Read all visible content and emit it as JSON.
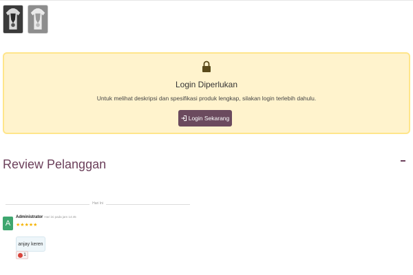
{
  "gallery": {
    "thumbnails": [
      {
        "name": "product-thumbnail-dark",
        "tone": "#3a3a3a"
      },
      {
        "name": "product-thumbnail-light",
        "tone": "#8d8d8d"
      }
    ]
  },
  "login_notice": {
    "icon": "lock-icon",
    "title": "Login Diperlukan",
    "description": "Untuk melihat deskripsi dan spesifikasi produk lengkap, silakan login terlebih dahulu.",
    "button_label": "Login Sekarang",
    "button_icon": "sign-in-icon",
    "background": "#fff3cd",
    "border": "#ffe58a",
    "button_color": "#6b4a5e"
  },
  "reviews": {
    "heading": "Review Pelanggan",
    "collapse_icon": "minus-icon",
    "day_label": "Hari Ini",
    "items": [
      {
        "avatar_letter": "A",
        "avatar_color": "#3ea66f",
        "author": "Administrator",
        "time": "Hari ini pada jam 14:45",
        "rating": 5,
        "comment": "anjay keren",
        "reaction_icon": "heart-reaction-icon",
        "reaction_count": "1"
      }
    ]
  },
  "colors": {
    "accent": "#6b3f5a",
    "star": "#f5b301"
  }
}
